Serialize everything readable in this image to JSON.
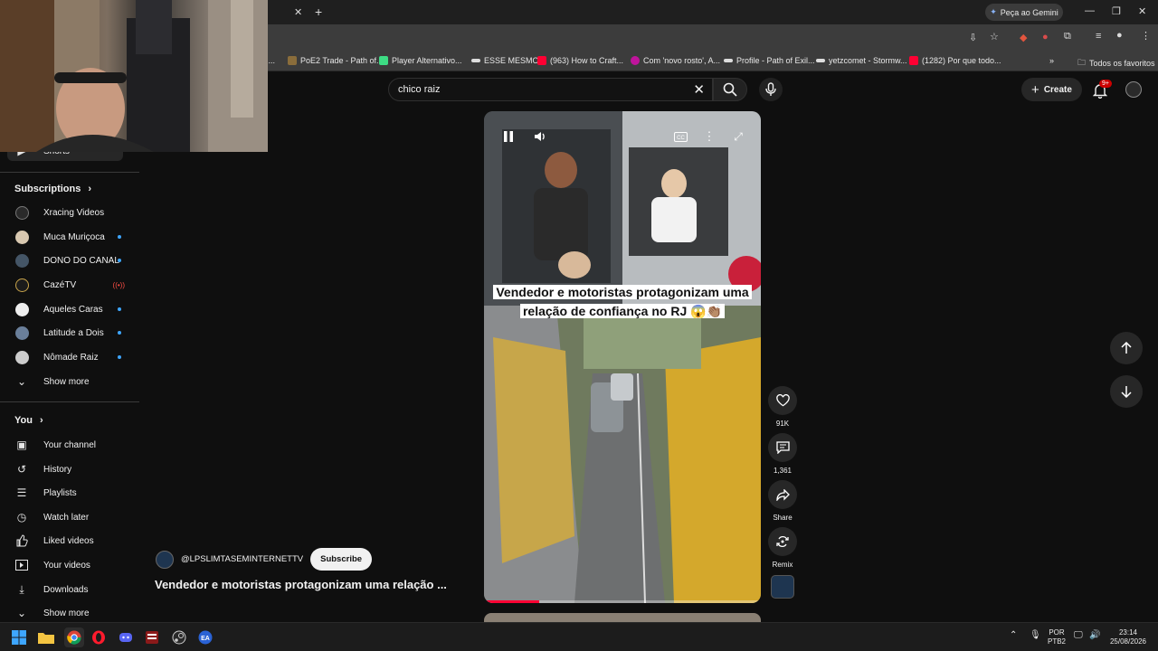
{
  "browser": {
    "gemini_label": "Peça ao Gemini",
    "bookmarks": [
      {
        "label": "I...",
        "color": "#c8a060"
      },
      {
        "label": "PoE2 Trade - Path of...",
        "color": "#8a6d3b"
      },
      {
        "label": "Player Alternativo...",
        "color": "#3ddc84"
      },
      {
        "label": "ESSE MESMO",
        "color": "#dddddd"
      },
      {
        "label": "(963) How to Craft...",
        "color": "#ff0033"
      },
      {
        "label": "Com 'novo rosto', A...",
        "color": "#c0149c"
      },
      {
        "label": "Profile - Path of Exil...",
        "color": "#dddddd"
      },
      {
        "label": "yetzcomet - Stormw...",
        "color": "#dddddd"
      },
      {
        "label": "(1282) Por que todo...",
        "color": "#ff0033"
      }
    ],
    "favorites_label": "Todos os favoritos"
  },
  "search": {
    "value": "chico raiz"
  },
  "header": {
    "create_label": "Create",
    "notification_count": "9+"
  },
  "sidebar": {
    "shorts_label": "Shorts",
    "subscriptions_title": "Subscriptions",
    "subscriptions": [
      {
        "label": "Xracing Videos",
        "avatar_color": "#2a2a2a",
        "indicator": "none"
      },
      {
        "label": "Muca Muriçoca",
        "avatar_color": "#d8c8b0",
        "indicator": "dot"
      },
      {
        "label": "DONO DO CANAL",
        "avatar_color": "#445566",
        "indicator": "dot"
      },
      {
        "label": "CazéTV",
        "avatar_color": "#1b1b1b",
        "indicator": "live"
      },
      {
        "label": "Aqueles Caras",
        "avatar_color": "#eeeeee",
        "indicator": "dot"
      },
      {
        "label": "Latitude a Dois",
        "avatar_color": "#6a7f9a",
        "indicator": "dot"
      },
      {
        "label": "Nômade Raiz",
        "avatar_color": "#cccccc",
        "indicator": "dot"
      }
    ],
    "show_more_label": "Show more",
    "you_title": "You",
    "you_items": [
      {
        "label": "Your channel",
        "icon": "channel-icon",
        "glyph": "▣"
      },
      {
        "label": "History",
        "icon": "history-icon",
        "glyph": "↺"
      },
      {
        "label": "Playlists",
        "icon": "playlists-icon",
        "glyph": "☰"
      },
      {
        "label": "Watch later",
        "icon": "clock-icon",
        "glyph": "◷"
      },
      {
        "label": "Liked videos",
        "icon": "thumbs-up-icon",
        "glyph": "👍"
      },
      {
        "label": "Your videos",
        "icon": "video-icon",
        "glyph": "▶"
      },
      {
        "label": "Downloads",
        "icon": "download-icon",
        "glyph": "⤓"
      }
    ],
    "show_more_label_2": "Show more"
  },
  "video": {
    "caption": "Vendedor e motoristas protagonizam uma relação de confiança no RJ 😱👏🏽",
    "progress": 0.2,
    "likes": "91K",
    "comments": "1,361",
    "share_label": "Share",
    "remix_label": "Remix",
    "channel": "@LPSLIMTASEMINTERNETTV",
    "subscribe_label": "Subscribe",
    "title": "Vendedor e motoristas protagonizam uma relação ..."
  },
  "taskbar": {
    "language": "POR",
    "layout": "PTB2",
    "time": "23:14",
    "date": "25/08/2026"
  }
}
